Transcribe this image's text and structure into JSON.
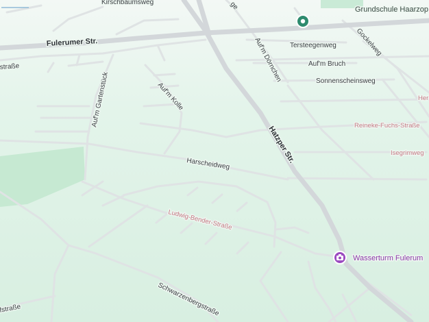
{
  "map": {
    "streets": {
      "kirschbaumsweg": "Kirschbaumsweg",
      "fulerumer": "Fulerumer Str.",
      "strasse_left": "straße",
      "tersteegenweg": "Tersteegenweg",
      "aufm_bruch": "Auf'm Bruch",
      "sonnenscheinsweg": "Sonnenscheinsweg",
      "aufm_doernchen": "Auf'm Dörnchen",
      "gockelweg": "Gockelweg",
      "aufm_gartenstueck": "Auf'm Gartenstück",
      "aufm_kolle": "Auf'm Kolle",
      "hatzper": "Hatzper Str.",
      "harscheidweg": "Harscheidweg",
      "reineke": "Reineke-Fuchs-Straße",
      "isegrimweg": "Isegrimweg",
      "her": "Her",
      "ludwig_bender": "Ludwig-Bender-Straße",
      "schwarzenberg": "Schwarzenbergstraße",
      "fstrasse": "fstraße",
      "top_partial": "ge"
    },
    "pois": {
      "school": {
        "label": "Grundschule Haarzop",
        "icon": "school-pin-icon",
        "color": "#2e8b6e"
      },
      "wasserturm": {
        "label": "Wasserturm Fulerum",
        "icon": "camera-pin-icon",
        "color": "#9b4bc0"
      }
    },
    "colors": {
      "land": "#e6f4ec",
      "park": "#c9ebd5",
      "road_major": "#d2d6d9",
      "road_minor": "#dde1e3"
    }
  }
}
